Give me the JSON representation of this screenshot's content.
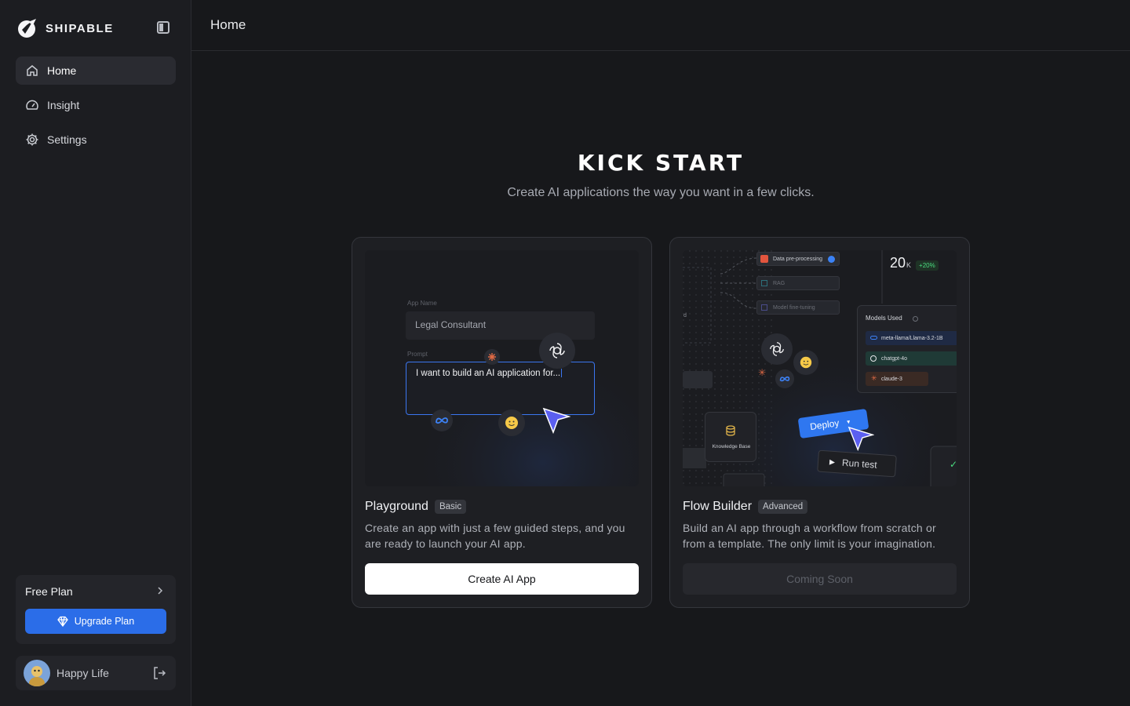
{
  "app": {
    "brand": "SHIPABLE"
  },
  "sidebar": {
    "nav": [
      {
        "label": "Home",
        "icon": "home-icon",
        "active": true
      },
      {
        "label": "Insight",
        "icon": "gauge-icon",
        "active": false
      },
      {
        "label": "Settings",
        "icon": "gear-icon",
        "active": false
      }
    ],
    "plan": {
      "title": "Free Plan",
      "upgrade_label": "Upgrade Plan"
    },
    "user": {
      "name": "Happy Life"
    }
  },
  "header": {
    "title": "Home"
  },
  "hero": {
    "title": "KICK START",
    "subtitle": "Create AI applications the way you want in a few clicks."
  },
  "cards": {
    "playground": {
      "title": "Playground",
      "badge": "Basic",
      "description": "Create an app with just a few guided steps, and you are ready to launch your AI app.",
      "button": "Create AI App",
      "preview": {
        "app_name_label": "App Name",
        "app_name_value": "Legal Consultant",
        "prompt_label": "Prompt",
        "prompt_value": "I want to build an AI application for..."
      }
    },
    "flow_builder": {
      "title": "Flow Builder",
      "badge": "Advanced",
      "description": "Build an AI app through a workflow from scratch or from a template. The only limit is your imagination.",
      "button": "Coming Soon",
      "preview": {
        "nodes": [
          "Data pre-processing",
          "RAG",
          "Model fine-tuning"
        ],
        "stat_value": "20",
        "stat_unit": "K",
        "stat_change": "+20%",
        "models_title": "Models Used",
        "models": [
          "meta-llama/Llama-3.2-1B",
          "chatgpt-4o",
          "claude-3"
        ],
        "knowledge_label": "Knowledge Base",
        "deploy_label": "Deploy",
        "run_label": "Run test",
        "edge_label": "d"
      }
    }
  },
  "colors": {
    "accent": "#2b6de8",
    "background": "#17181b",
    "sidebar": "#1c1d21"
  }
}
